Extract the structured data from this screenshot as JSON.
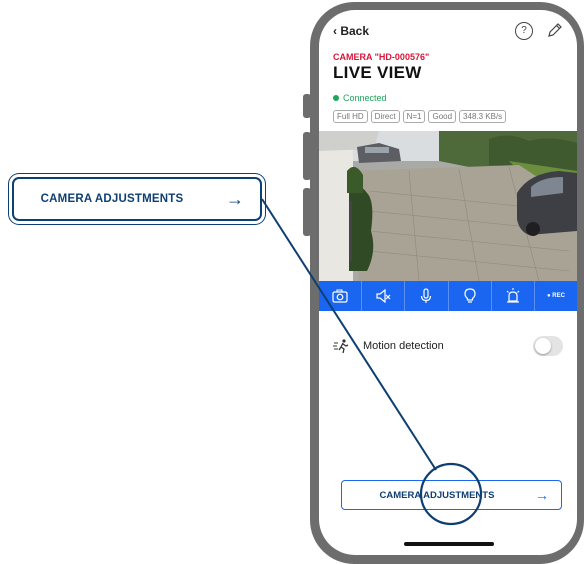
{
  "callout": {
    "label": "CAMERA ADJUSTMENTS",
    "arrow": "→"
  },
  "app": {
    "back_label": "Back",
    "help_glyph": "?",
    "camera_id": "CAMERA \"HD-000576\"",
    "title": "LIVE VIEW",
    "status": "Connected",
    "chips": [
      "Full HD",
      "Direct",
      "N=1",
      "Good",
      "348.3 KB/s"
    ],
    "toolbar": {
      "items": [
        "snapshot-icon",
        "speaker-mute-icon",
        "microphone-icon",
        "light-bulb-icon",
        "siren-icon",
        "record-icon"
      ],
      "rec_label": "● REC"
    },
    "motion_detection": {
      "label": "Motion detection",
      "enabled": false
    },
    "adjust_button": {
      "label": "CAMERA ADJUSTMENTS",
      "arrow": "→"
    }
  },
  "colors": {
    "accent_blue": "#1a66f0",
    "navy": "#0e3f73",
    "brand_red": "#d6163c",
    "status_green": "#1ea65a",
    "phone_frame": "#6d6d6d"
  }
}
